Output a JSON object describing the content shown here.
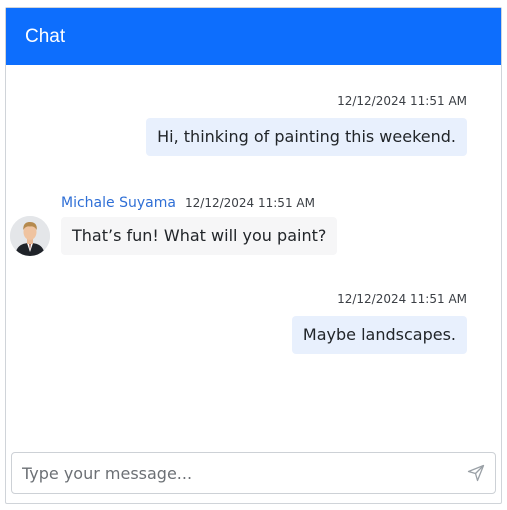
{
  "header": {
    "title": "Chat"
  },
  "messages": [
    {
      "direction": "outgoing",
      "timestamp": "12/12/2024 11:51 AM",
      "text": "Hi, thinking of painting this weekend."
    },
    {
      "direction": "incoming",
      "sender": "Michale Suyama",
      "timestamp": "12/12/2024 11:51 AM",
      "text": "That’s fun! What will you paint?",
      "avatar_icon": "user-avatar-icon"
    },
    {
      "direction": "outgoing",
      "timestamp": "12/12/2024 11:51 AM",
      "text": "Maybe landscapes."
    }
  ],
  "composer": {
    "placeholder": "Type your message...",
    "value": "",
    "send_icon": "send-icon"
  },
  "colors": {
    "header_bg": "#0d6efd",
    "outgoing_bubble": "#e8f0fd",
    "incoming_bubble": "#f6f6f7",
    "sender_name": "#2f6fd6"
  }
}
